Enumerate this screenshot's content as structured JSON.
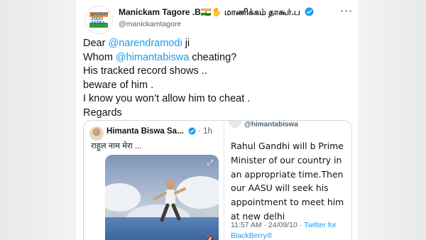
{
  "tweet": {
    "author_name": "Manickam Tagore .B🇮🇳✋ மாணிக்கம் தாகூர்.ப",
    "author_handle": "@manickamtagore",
    "more_icon": "more-horizontal-icon",
    "avatar_text": "BHARAT JODO YATRA",
    "body": {
      "line1_prefix": "Dear ",
      "line1_mention": "@narendramodi",
      "line1_suffix": " ji",
      "line2_prefix": "Whom ",
      "line2_mention": "@himantabiswa",
      "line2_suffix": " cheating?",
      "line3": "His tracked record shows ..",
      "line4": "beware of him .",
      "line5": "I know you won’t allow him to cheat .",
      "line6": "Regards"
    },
    "colors": {
      "mention": "#1d9bf0",
      "verified": "#1d9bf0"
    }
  },
  "quote": {
    "name": "Himanta Biswa Sa...",
    "time": "1h",
    "text": "राहुल नाम मेरा ..."
  },
  "embedded": {
    "handle": "@himantabiswa",
    "body": "Rahul Gandhi will b Prime Minister of our country in an appropriate time.Then our AASU will seek his appointment to meet him at new delhi",
    "time": "11:57 AM · 24/09/10 · ",
    "source": "Twitter for BlackBerry®"
  }
}
